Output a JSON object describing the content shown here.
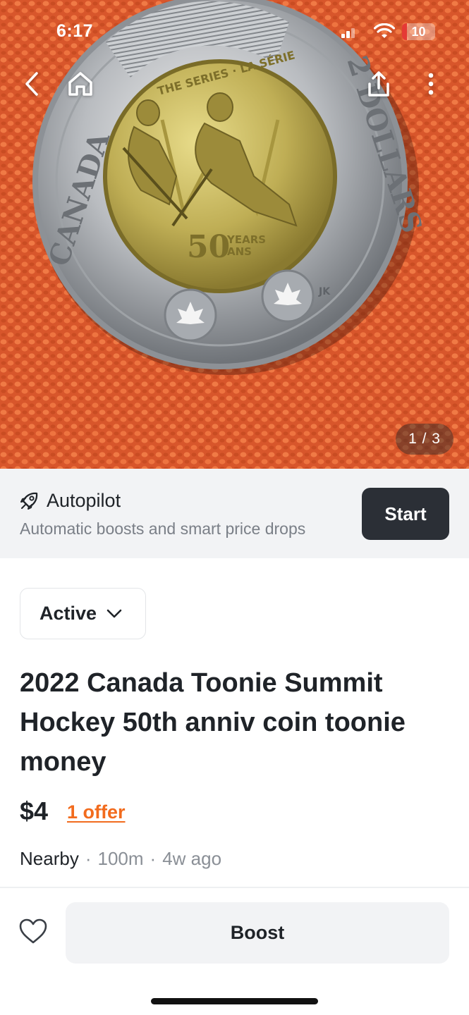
{
  "status_bar": {
    "time": "6:17",
    "battery_level": "10",
    "icons": [
      "signal-icon",
      "wifi-icon",
      "battery-icon"
    ]
  },
  "photo": {
    "counter": "1 / 3",
    "nav_icons": [
      "back-chevron-icon",
      "home-icon",
      "share-icon",
      "more-vertical-icon"
    ],
    "coin_text": {
      "left": "CANADA",
      "right": "2 DOLLARS",
      "top": "THE SERIES · LA SÉRIE",
      "big_number": "50",
      "years": "YEARS",
      "ans": "ANS",
      "initials": "JK"
    }
  },
  "autopilot": {
    "icon": "rocket-icon",
    "title": "Autopilot",
    "subtitle": "Automatic boosts and smart price drops",
    "button_label": "Start"
  },
  "listing": {
    "status": "Active",
    "title": "2022 Canada Toonie Summit Hockey 50th anniv coin toonie money",
    "price": "$4",
    "offers": "1 offer",
    "location": "Nearby",
    "distance": "100m",
    "posted": "4w ago"
  },
  "bottom_bar": {
    "boost_label": "Boost",
    "favorite_icon": "heart-icon"
  },
  "colors": {
    "accent_orange": "#f26b1d",
    "dark_button": "#2b2f36",
    "panel_gray": "#f2f3f5"
  }
}
